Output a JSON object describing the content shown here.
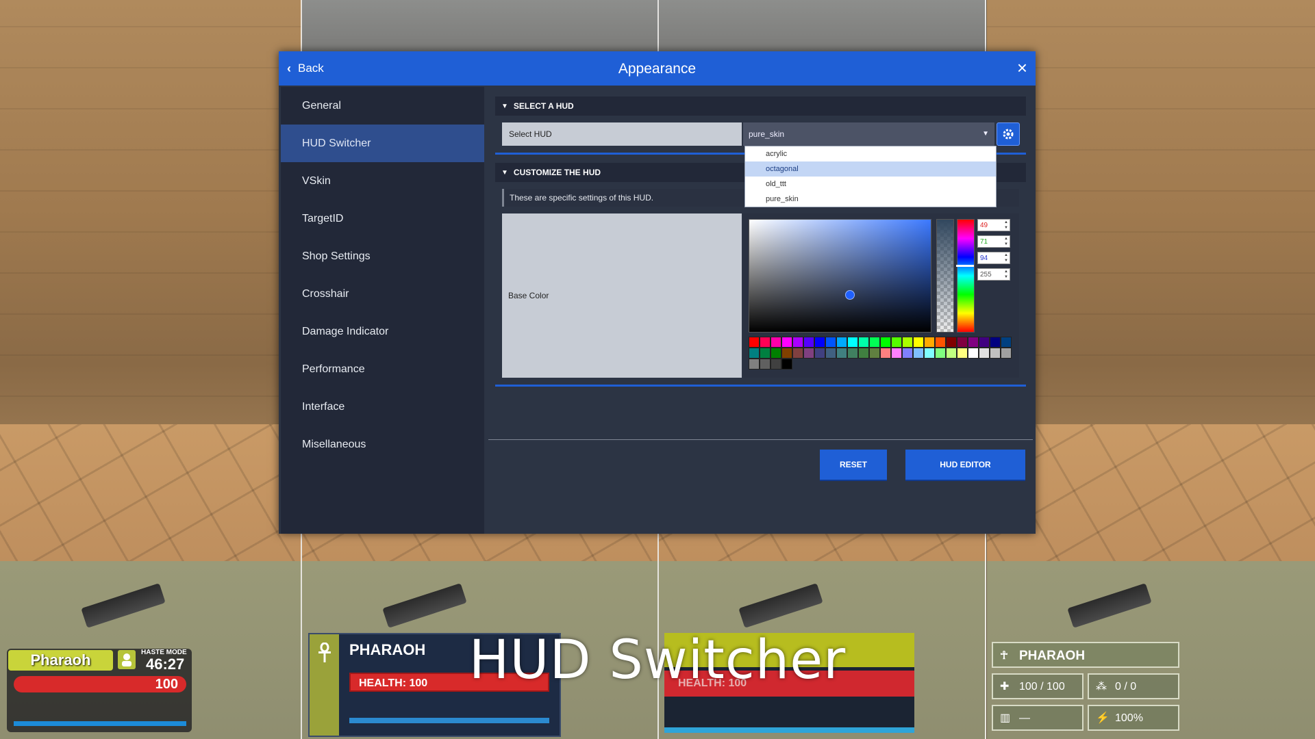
{
  "dialog": {
    "title": "Appearance",
    "back_label": "Back",
    "close_icon": "×"
  },
  "sidebar": {
    "items": [
      {
        "label": "General"
      },
      {
        "label": "HUD Switcher",
        "active": true
      },
      {
        "label": "VSkin"
      },
      {
        "label": "TargetID"
      },
      {
        "label": "Shop Settings"
      },
      {
        "label": "Crosshair"
      },
      {
        "label": "Damage Indicator"
      },
      {
        "label": "Performance"
      },
      {
        "label": "Interface"
      },
      {
        "label": "Misellaneous"
      }
    ]
  },
  "select_hud": {
    "section_title": "SELECT A HUD",
    "label": "Select HUD",
    "current_value": "pure_skin",
    "options": [
      "acrylic",
      "octagonal",
      "old_ttt",
      "pure_skin"
    ],
    "highlighted_option": "octagonal"
  },
  "customize_hud": {
    "section_title": "CUSTOMIZE THE HUD",
    "description": "These are specific settings of this HUD.",
    "base_color_label": "Base Color",
    "rgba": {
      "r": "49",
      "g": "71",
      "b": "94",
      "a": "255"
    }
  },
  "swatches": [
    "#ff0000",
    "#ff0055",
    "#ff00aa",
    "#ff00ff",
    "#aa00ff",
    "#5500ff",
    "#0000ff",
    "#0055ff",
    "#00aaff",
    "#00ffff",
    "#00ffaa",
    "#00ff55",
    "#00ff00",
    "#55ff00",
    "#aaff00",
    "#ffff00",
    "#ffaa00",
    "#ff5500",
    "#800000",
    "#800040",
    "#800080",
    "#400080",
    "#000080",
    "#004080",
    "#008080",
    "#008040",
    "#008000",
    "#804000",
    "#804040",
    "#804080",
    "#404080",
    "#406080",
    "#408080",
    "#408060",
    "#408040",
    "#608040",
    "#ff8080",
    "#ff80ff",
    "#8080ff",
    "#80c0ff",
    "#80ffff",
    "#80ff80",
    "#c0ff80",
    "#ffff80",
    "#ffffff",
    "#e0e0e0",
    "#c0c0c0",
    "#a0a0a0",
    "#808080",
    "#606060",
    "#404040",
    "#000000"
  ],
  "buttons": {
    "reset": "RESET",
    "hud_editor": "HUD EDITOR"
  },
  "overlay_title": "HUD Switcher",
  "hud_previews": {
    "hud1": {
      "name": "Pharaoh",
      "mode": "HASTE MODE",
      "time": "46:27",
      "health": "100"
    },
    "hud2": {
      "name": "PHARAOH",
      "health": "HEALTH: 100"
    },
    "hud3": {
      "health": "HEALTH: 100"
    },
    "hud4": {
      "name": "PHARAOH",
      "health": "100 / 100",
      "ammo": "0 / 0",
      "stat": "—",
      "speed": "100%"
    }
  },
  "colors": {
    "accent": "#1f5fd6",
    "sidebar": "#222838",
    "panel": "#2c3444"
  }
}
